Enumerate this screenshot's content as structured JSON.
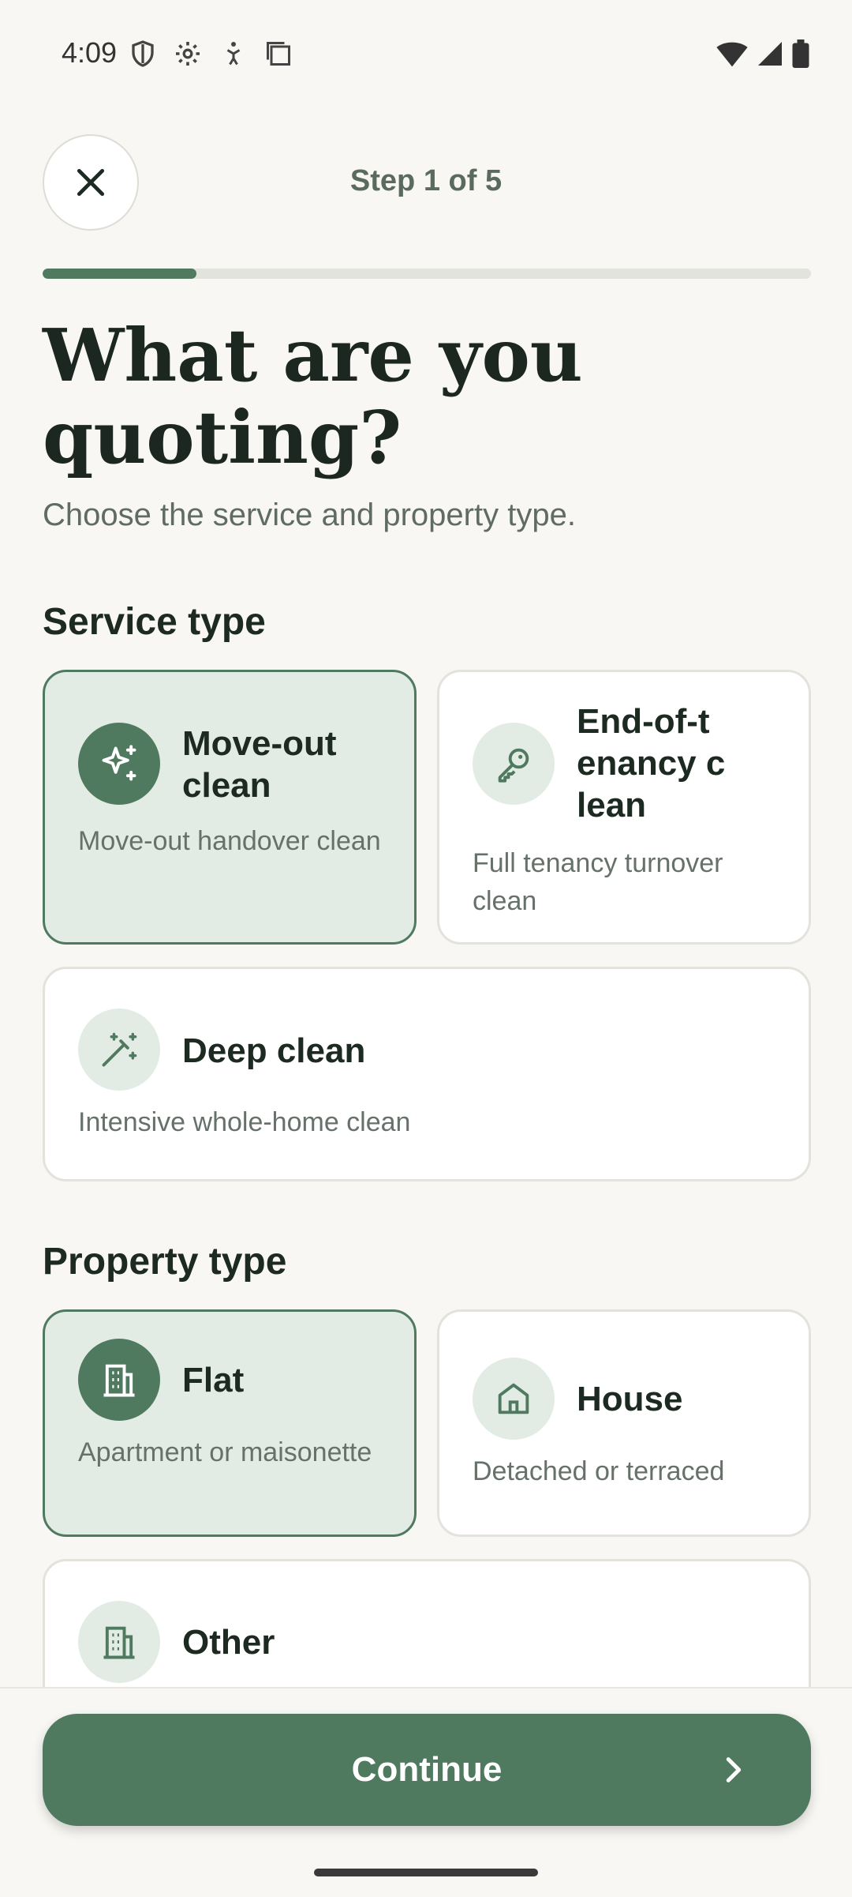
{
  "status_bar": {
    "time": "4:09",
    "left_icons": [
      "shield-icon",
      "settings-icon",
      "accessibility-icon",
      "screenshot-icon"
    ],
    "right_icons": [
      "wifi-icon",
      "cellular-signal-icon",
      "battery-icon"
    ]
  },
  "header": {
    "step_label": "Step 1 of 5",
    "progress": 0.2
  },
  "title": "What are you quoting?",
  "subtitle": "Choose the service and property type.",
  "service_section": {
    "label": "Service type",
    "options": [
      {
        "title": "Move-out clean",
        "description": "Move-out handover clean",
        "icon": "sparkle-icon",
        "selected": true
      },
      {
        "title": "End-of-tenancy clean",
        "description": "Full tenancy turnover clean",
        "icon": "key-icon",
        "selected": false
      },
      {
        "title": "Deep clean",
        "description": "Intensive whole-home clean",
        "icon": "magic-wand-icon",
        "selected": false
      }
    ]
  },
  "property_section": {
    "label": "Property type",
    "options": [
      {
        "title": "Flat",
        "description": "Apartment or maisonette",
        "icon": "building-icon",
        "selected": true
      },
      {
        "title": "House",
        "description": "Detached or terraced",
        "icon": "house-icon",
        "selected": false
      },
      {
        "title": "Other",
        "description": "",
        "icon": "building-icon",
        "selected": false
      }
    ]
  },
  "continue_button": {
    "label": "Continue"
  },
  "colors": {
    "accent": "#4f7a5f",
    "selected_bg": "#e3ece4",
    "background": "#f8f7f3"
  }
}
